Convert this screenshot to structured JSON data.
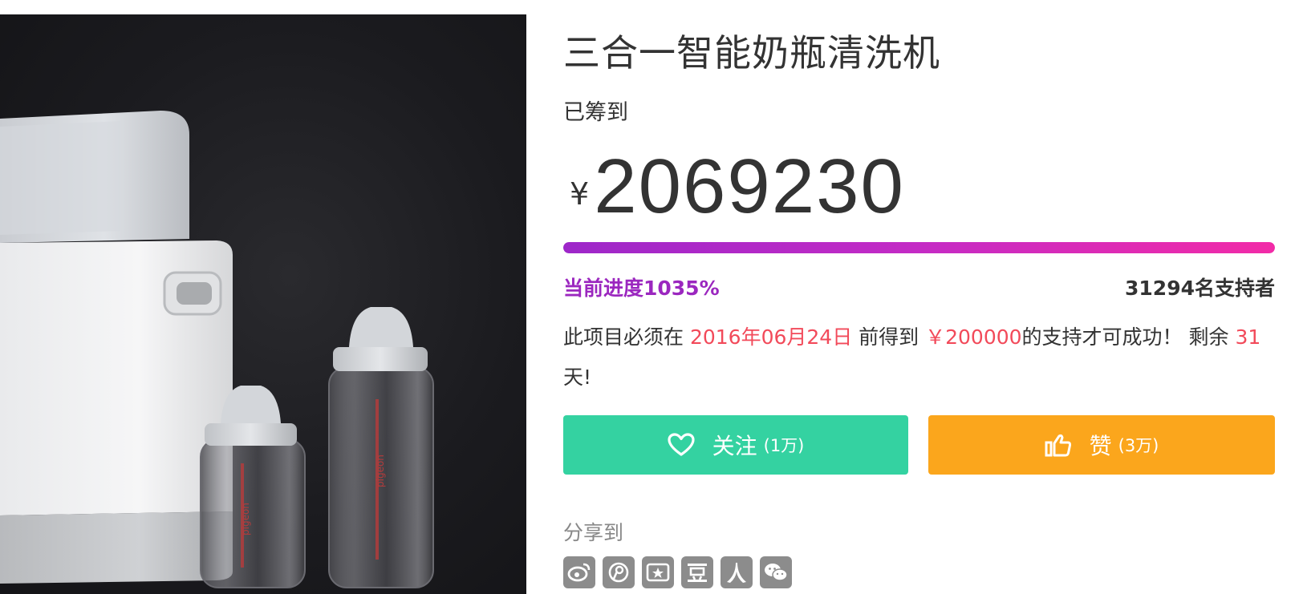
{
  "product": {
    "title": "三合一智能奶瓶清洗机",
    "image_alt": "bottle-washer-with-bottles"
  },
  "funding": {
    "raised_label": "已筹到",
    "currency": "¥",
    "amount": "2069230",
    "progress_label": "当前进度1035%",
    "progress_percent": 1035,
    "supporters_label": "31294名支持者"
  },
  "deadline": {
    "prefix": "此项目必须在 ",
    "date": "2016年06月24日",
    "mid": " 前得到 ",
    "goal": "￥200000",
    "suffix": "的支持才可成功！ 剩余 ",
    "days": "31",
    "days_suffix": "天!"
  },
  "actions": {
    "follow_label": "关注",
    "follow_count": "(1万)",
    "like_label": "赞",
    "like_count": "(3万)"
  },
  "share": {
    "label": "分享到",
    "icons": [
      "weibo-icon",
      "tencent-weibo-icon",
      "qzone-icon",
      "douban-icon",
      "renren-icon",
      "wechat-icon"
    ]
  },
  "colors": {
    "progress_start": "#9d27c9",
    "progress_end": "#f22ba7",
    "highlight": "#f24a5a",
    "follow_button": "#34d2a1",
    "like_button": "#fba61c",
    "share_icon": "#8c8c8c"
  }
}
